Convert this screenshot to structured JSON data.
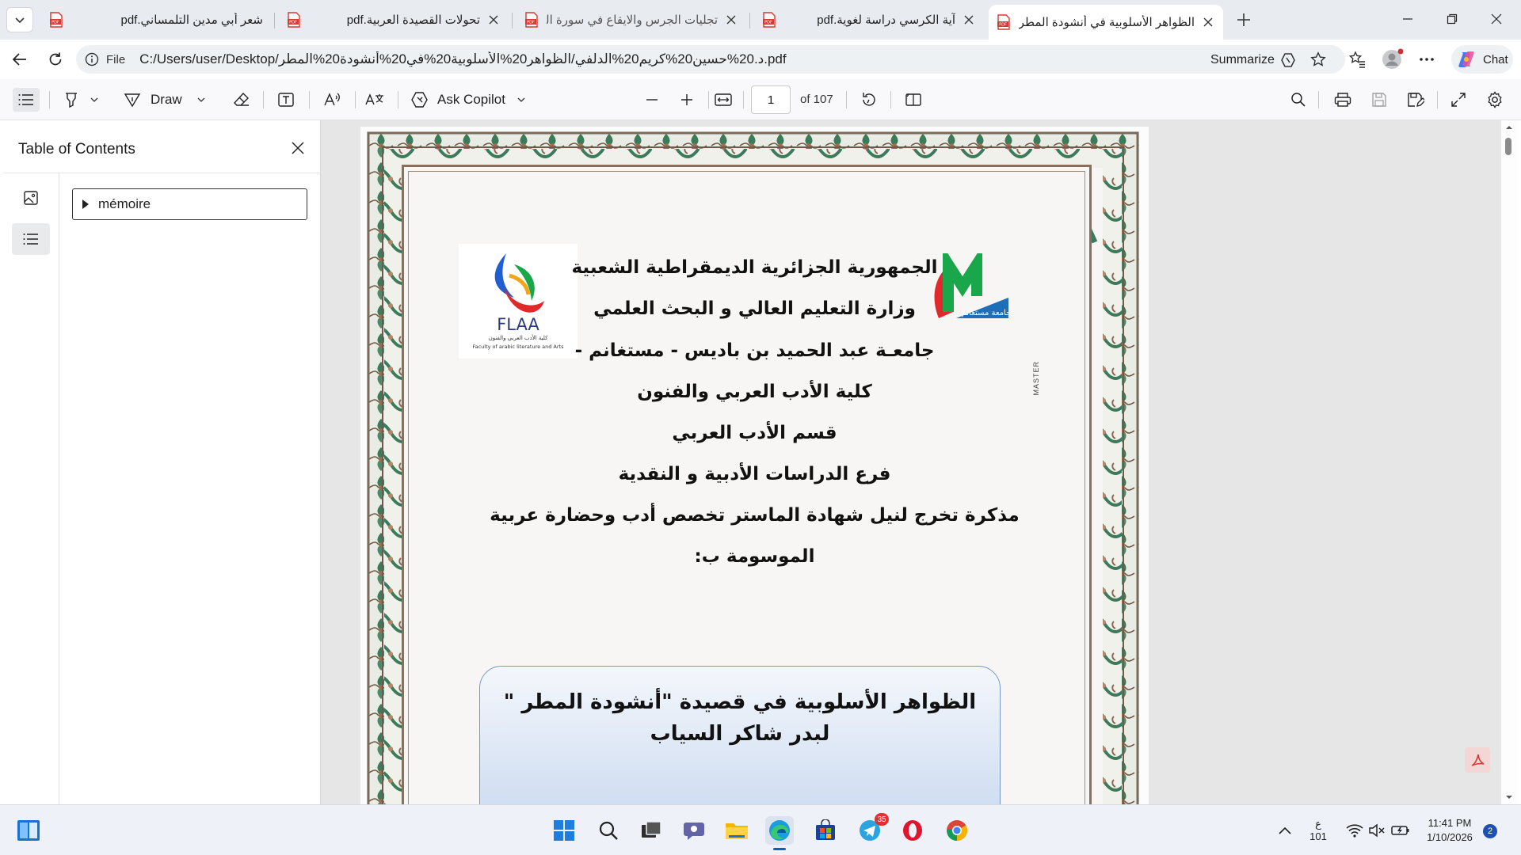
{
  "browser": {
    "tabs": [
      {
        "title": "شعر أبي مدين التلمساني.pdf",
        "active": false
      },
      {
        "title": "تحولات القصيدة العربية.pdf",
        "active": false
      },
      {
        "title": "تجليات الجرس والايقاع في سورة الكر",
        "active": false
      },
      {
        "title": "آية الكرسي دراسة لغوية.pdf",
        "active": false
      },
      {
        "title": "الظواهر الأسلوبية في أنشودة المطر",
        "active": true
      }
    ],
    "address": {
      "file_label": "File",
      "url": "C:/Users/user/Desktop/د.20%حسين20%كريم20%الدلفي/الظواهر20%الأسلوبية20%في20%أنشودة20%المطر.pdf",
      "summarize_label": "Summarize"
    },
    "chat_label": "Chat"
  },
  "pdf_toolbar": {
    "draw_label": "Draw",
    "copilot_label": "Ask Copilot",
    "page_current": "1",
    "page_total_label": "of 107"
  },
  "sidebar": {
    "title": "Table of Contents",
    "items": [
      {
        "label": "mémoire"
      }
    ]
  },
  "document": {
    "lines": [
      "الجمهورية الجزائرية الديمقراطية الشعبية",
      "وزارة التعليم العالي و البحث العلمي",
      "جامعـة  عبد الحميد بن باديس - مستغانم -",
      "كلية الأدب العربي والفنون",
      "قسم الأدب العربي",
      "فرع الدراسات الأدبية و النقدية",
      "مذكرة تخرج لنيل شهادة الماستر تخصص أدب وحضارة عربية",
      "الموسومة ب:"
    ],
    "title_line1": "الظواهر الأسلوبية في قصيدة \"أنشودة المطر \"",
    "title_line2": "لبدر شاكر السياب",
    "logo_left_text": "FLAA",
    "logo_left_sub": "Faculty of arabic literature and Arts",
    "logo_left_ar": "كلية الأدب العربي والفنون",
    "logo_right_text": "جامعة مستغانم",
    "vertical_text": "MASTER"
  },
  "taskbar": {
    "telegram_badge": "35",
    "lang_top": "ع",
    "lang_bottom": "101",
    "time": "11:41 PM",
    "date": "1/10/2026",
    "notifications": "2"
  },
  "colors": {
    "accent": "#0067c0",
    "tabstrip_bg": "#e8ebf0",
    "pdf_red": "#d33b30",
    "frame_green": "#3b7a5a",
    "title_box_fill": "#c9d9ef"
  }
}
